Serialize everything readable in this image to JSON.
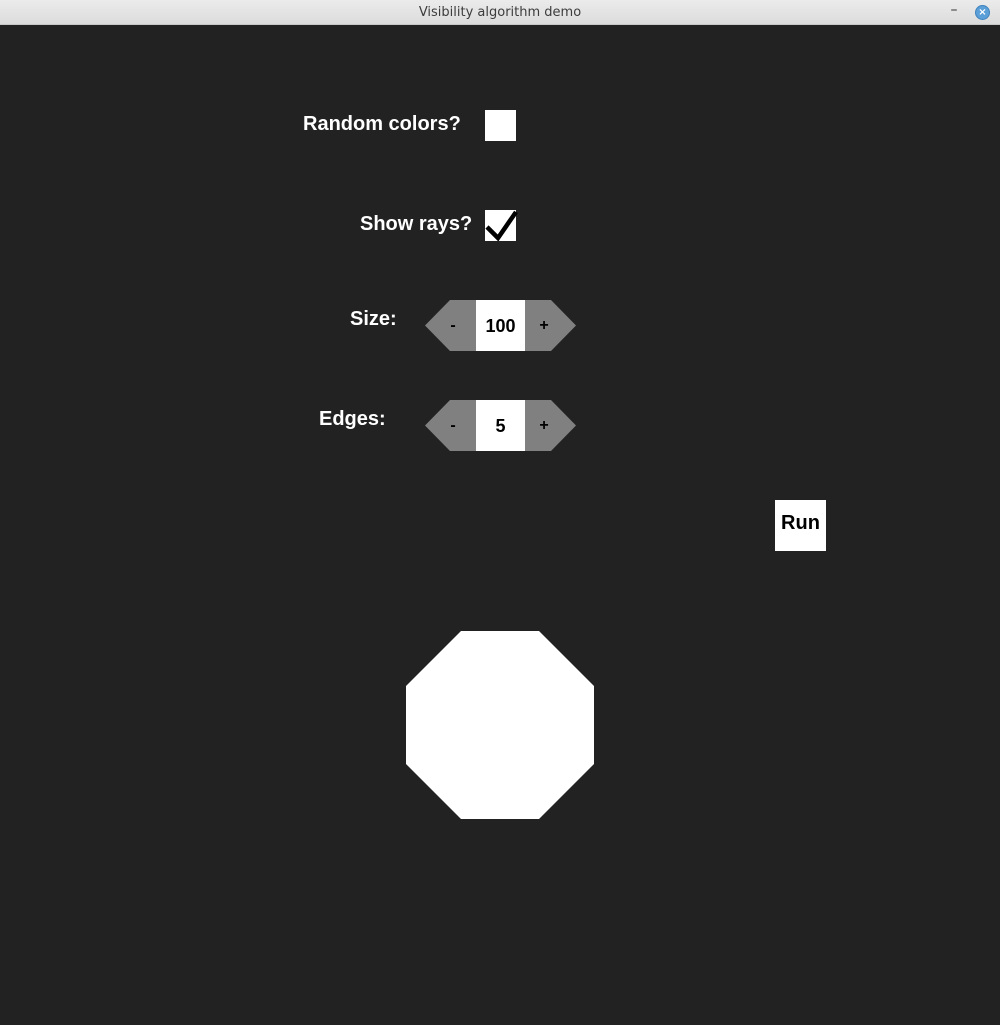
{
  "window": {
    "title": "Visibility algorithm demo",
    "minimize_glyph": "–",
    "close_glyph": "×"
  },
  "controls": {
    "random_colors": {
      "label": "Random colors?",
      "checked": false
    },
    "show_rays": {
      "label": "Show rays?",
      "checked": true
    },
    "size": {
      "label": "Size:",
      "value": "100",
      "decrement": "-",
      "increment": "+"
    },
    "edges": {
      "label": "Edges:",
      "value": "5",
      "decrement": "-",
      "increment": "+"
    },
    "run": {
      "label": "Run"
    }
  },
  "colors": {
    "background": "#222222",
    "foreground": "#ffffff",
    "stepper_button": "#808080"
  }
}
